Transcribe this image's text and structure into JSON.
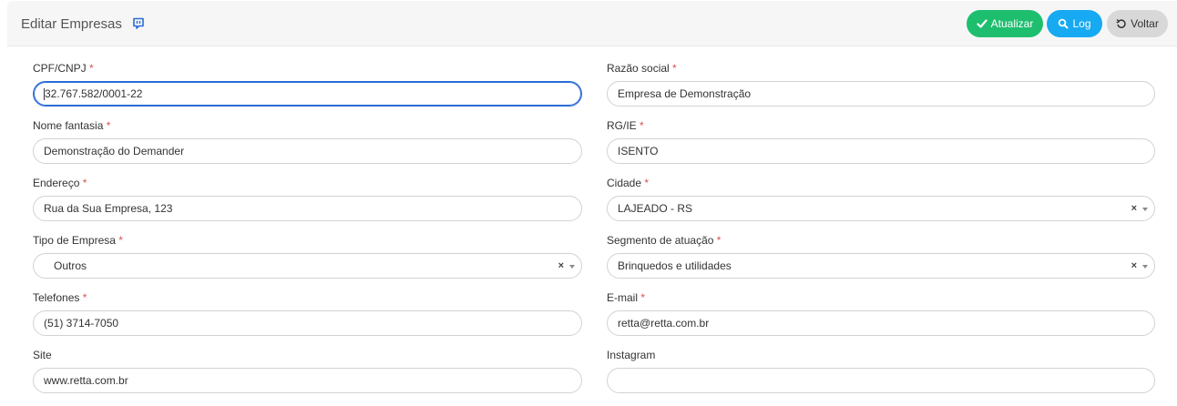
{
  "header": {
    "title": "Editar Empresas",
    "buttons": {
      "update": "Atualizar",
      "log": "Log",
      "back": "Voltar"
    }
  },
  "form": {
    "required_mark": "*",
    "cpf_cnpj": {
      "label": "CPF/CNPJ",
      "value": "32.767.582/0001-22"
    },
    "razao_social": {
      "label": "Razão social",
      "value": "Empresa de Demonstração"
    },
    "nome_fantasia": {
      "label": "Nome fantasia",
      "value": "Demonstração do Demander"
    },
    "rg_ie": {
      "label": "RG/IE",
      "value": "ISENTO"
    },
    "endereco": {
      "label": "Endereço",
      "value": "Rua da Sua Empresa, 123"
    },
    "cidade": {
      "label": "Cidade",
      "value": "LAJEADO - RS",
      "clear": "×"
    },
    "tipo_empresa": {
      "label": "Tipo de Empresa",
      "value": "Outros",
      "clear": "×"
    },
    "segmento": {
      "label": "Segmento de atuação",
      "value": "Brinquedos e utilidades",
      "clear": "×"
    },
    "telefones": {
      "label": "Telefones",
      "value": "(51) 3714-7050"
    },
    "email": {
      "label": "E-mail",
      "value": "retta@retta.com.br"
    },
    "site": {
      "label": "Site",
      "value": "www.retta.com.br"
    },
    "instagram": {
      "label": "Instagram",
      "value": ""
    }
  },
  "colors": {
    "update": "#1ebe6f",
    "log": "#17a9f2",
    "back": "#d8d8d8",
    "focus": "#2b6cd6",
    "required": "#d9534f"
  }
}
